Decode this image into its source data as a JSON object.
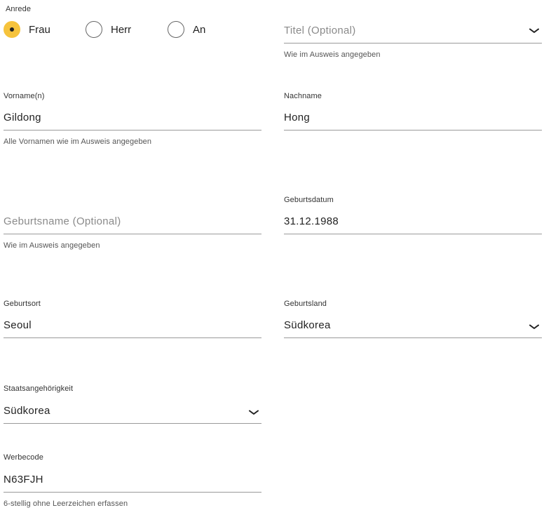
{
  "salutation": {
    "label": "Anrede",
    "options": [
      "Frau",
      "Herr",
      "An"
    ],
    "selected": "Frau"
  },
  "title": {
    "placeholder": "Titel (Optional)",
    "hint": "Wie im Ausweis angegeben"
  },
  "first_name": {
    "label": "Vorname(n)",
    "value": "Gildong",
    "hint": "Alle Vornamen wie im Ausweis angegeben"
  },
  "last_name": {
    "label": "Nachname",
    "value": "Hong"
  },
  "birth_name": {
    "placeholder": "Geburtsname (Optional)",
    "hint": "Wie im Ausweis angegeben"
  },
  "birth_date": {
    "label": "Geburtsdatum",
    "value": "31.12.1988"
  },
  "birth_place": {
    "label": "Geburtsort",
    "value": "Seoul"
  },
  "birth_country": {
    "label": "Geburtsland",
    "value": "Südkorea"
  },
  "nationality": {
    "label": "Staatsangehörigkeit",
    "value": "Südkorea"
  },
  "promo_code": {
    "label": "Werbecode",
    "value": "N63FJH",
    "hint": "6-stellig ohne Leerzeichen erfassen"
  },
  "colors": {
    "accent": "#f6c33c",
    "text": "#222222",
    "placeholder": "#8a8a8a",
    "underline": "#9a9a9a"
  },
  "icons": {
    "select": "chevron-down-icon",
    "radio_checked": "radio-checked-icon",
    "radio_unchecked": "radio-unchecked-icon"
  }
}
